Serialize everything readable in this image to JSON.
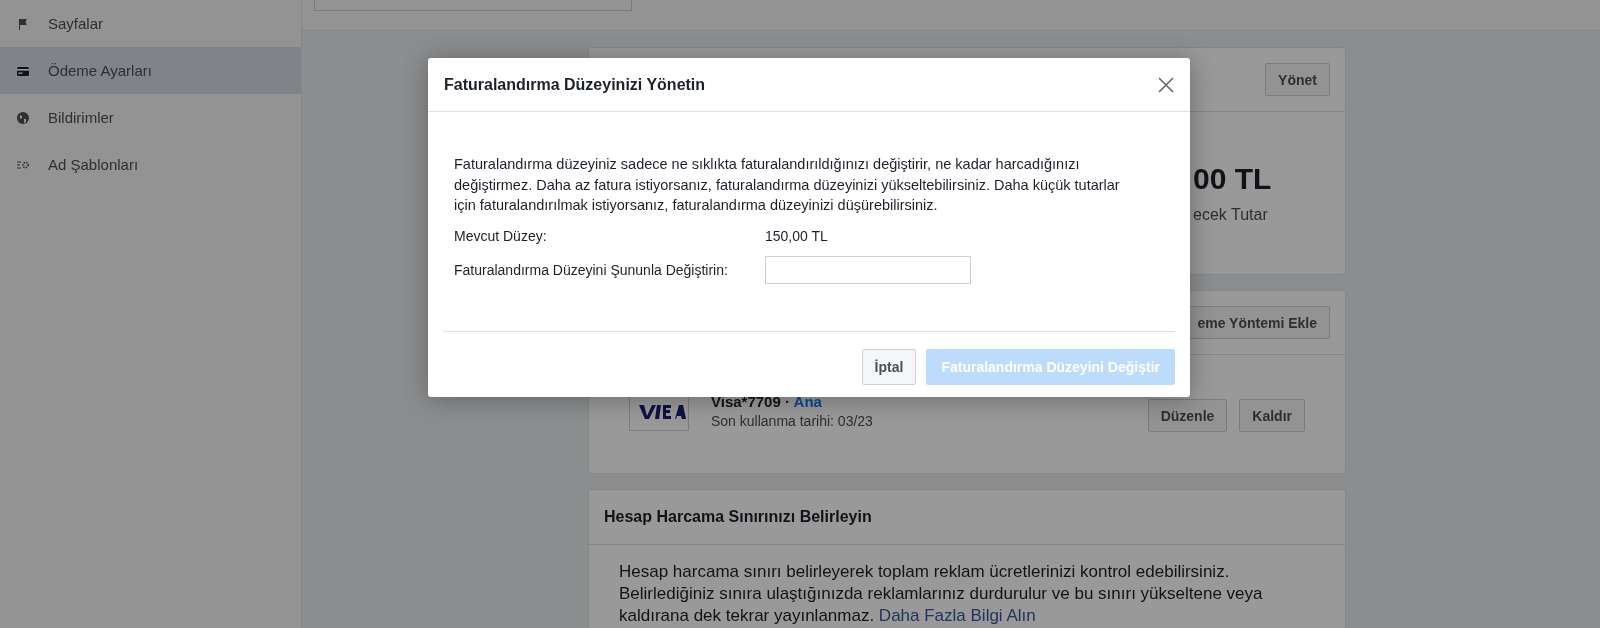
{
  "sidebar": {
    "items": [
      {
        "label": "Sayfalar",
        "selected": false
      },
      {
        "label": "Ödeme Ayarları",
        "selected": true
      },
      {
        "label": "Bildirimler",
        "selected": false
      },
      {
        "label": "Ad Şablonları",
        "selected": false
      }
    ]
  },
  "cards": [
    {
      "kind": "billing",
      "button": "Yönet",
      "amount": "00 TL",
      "amount_label": "ecek Tutar"
    },
    {
      "kind": "payment",
      "button": "eme Yöntemi Ekle",
      "card_name": "Visa*7709 · ",
      "card_tag": "Ana",
      "expiry": "Son kullanma tarihi: 03/23",
      "actions": [
        "Düzenle",
        "Kaldır"
      ]
    },
    {
      "kind": "limit",
      "title": "Hesap Harcama Sınırınızı Belirleyin",
      "text": "Hesap harcama sınırı belirleyerek toplam reklam ücretlerinizi kontrol edebilirsiniz. Belirlediğiniz sınıra ulaştığınızda reklamlarınız durdurulur ve bu sınırı yükseltene veya kaldırana dek tekrar yayınlanmaz. ",
      "link": "Daha Fazla Bilgi Alın"
    }
  ],
  "dialog": {
    "title": "Faturalandırma Düzeyinizi Yönetin",
    "description": "Faturalandırma düzeyiniz sadece ne sıklıkta faturalandırıldığınızı değiştirir, ne kadar harcadığınızı değiştirmez. Daha az fatura istiyorsanız, faturalandırma düzeyinizi yükseltebilirsiniz. Daha küçük tutarlar için faturalandırılmak istiyorsanız, faturalandırma düzeyinizi düşürebilirsiniz.",
    "current_label": "Mevcut Düzey:",
    "current_value": "150,00 TL",
    "change_label": "Faturalandırma Düzeyini Şununla Değiştirin:",
    "cancel_button": "İptal",
    "confirm_button": {
      "label": "Faturalandırma Düzeyini Değiştir",
      "disabled": true
    }
  }
}
